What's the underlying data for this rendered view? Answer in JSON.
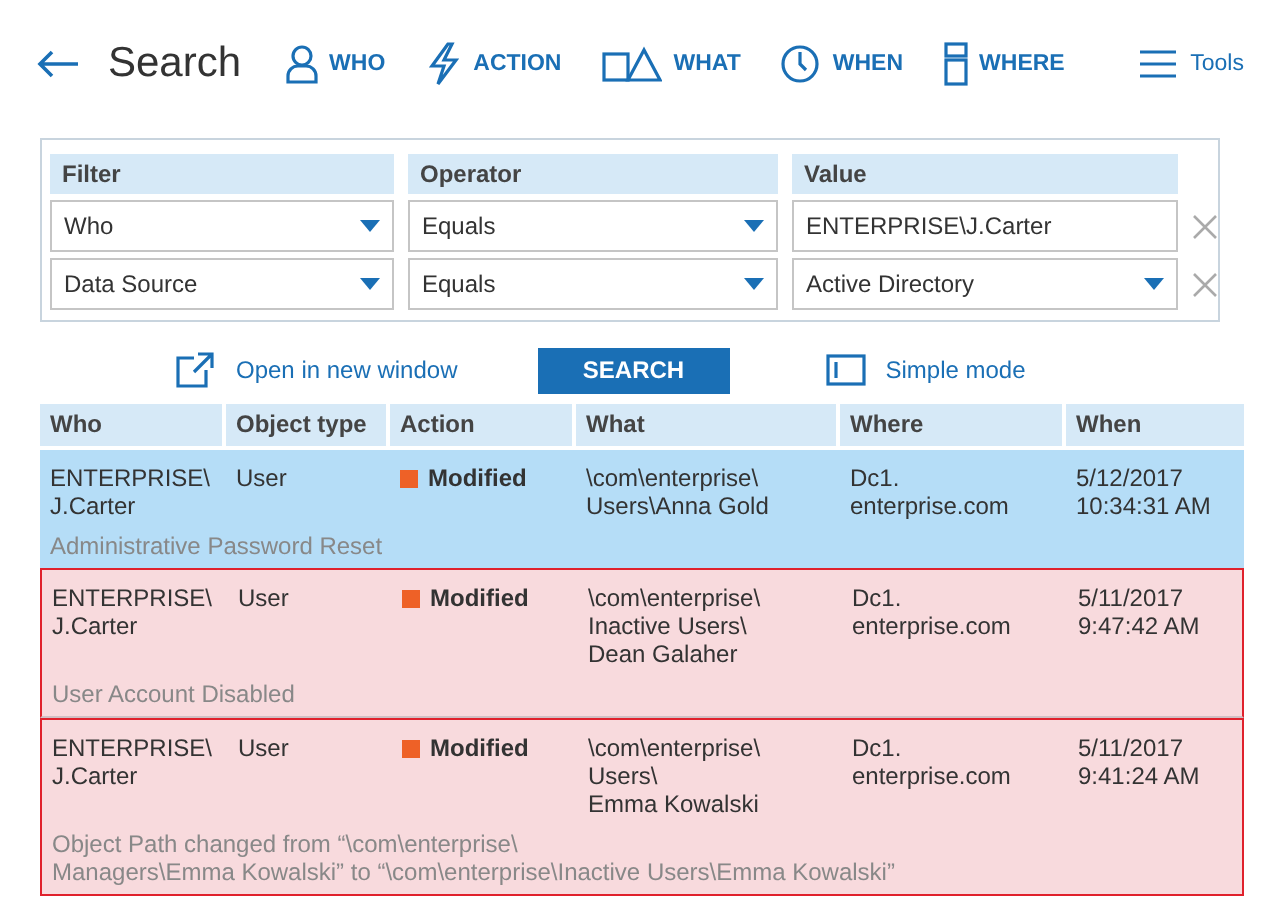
{
  "header": {
    "title": "Search",
    "nav": [
      {
        "kind": "person",
        "label": "WHO"
      },
      {
        "kind": "bolt",
        "label": "ACTION"
      },
      {
        "kind": "shapes",
        "label": "WHAT"
      },
      {
        "kind": "clock",
        "label": "WHEN"
      },
      {
        "kind": "server",
        "label": "WHERE"
      },
      {
        "kind": "menu",
        "label": "Tools"
      }
    ]
  },
  "filters": {
    "columns": [
      "Filter",
      "Operator",
      "Value"
    ],
    "rows": [
      {
        "filter": "Who",
        "operator": "Equals",
        "value": "ENTERPRISE\\J.Carter",
        "kind": "text"
      },
      {
        "filter": "Data Source",
        "operator": "Equals",
        "value": "Active Directory",
        "kind": "dropdown"
      }
    ]
  },
  "actions": {
    "open_link": "Open in new window",
    "search_button": "SEARCH",
    "mode_link": "Simple mode"
  },
  "table": {
    "columns": [
      "Who",
      "Object type",
      "Action",
      "What",
      "Where",
      "When"
    ],
    "rows": [
      {
        "selected": true,
        "alert": false,
        "who": "ENTERPRISE\\\nJ.Carter",
        "object_type": "User",
        "action": "Modified",
        "what": "\\com\\enterprise\\\nUsers\\Anna Gold",
        "where": "Dc1.\nenterprise.com",
        "when": "5/12/2017\n10:34:31 AM",
        "details": "Administrative Password Reset"
      },
      {
        "selected": false,
        "alert": true,
        "who": "ENTERPRISE\\\nJ.Carter",
        "object_type": "User",
        "action": "Modified",
        "what": "\\com\\enterprise\\\nInactive Users\\\nDean Galaher",
        "where": "Dc1.\nenterprise.com",
        "when": "5/11/2017\n9:47:42 AM",
        "details": "User Account Disabled"
      },
      {
        "selected": false,
        "alert": true,
        "who": "ENTERPRISE\\\nJ.Carter",
        "object_type": "User",
        "action": "Modified",
        "what": "\\com\\enterprise\\\nUsers\\\nEmma Kowalski",
        "where": "Dc1.\nenterprise.com",
        "when": "5/11/2017\n9:41:24 AM",
        "details": "Object Path changed from “\\com\\enterprise\\\nManagers\\Emma Kowalski” to “\\com\\enterprise\\Inactive Users\\Emma Kowalski”"
      }
    ]
  }
}
